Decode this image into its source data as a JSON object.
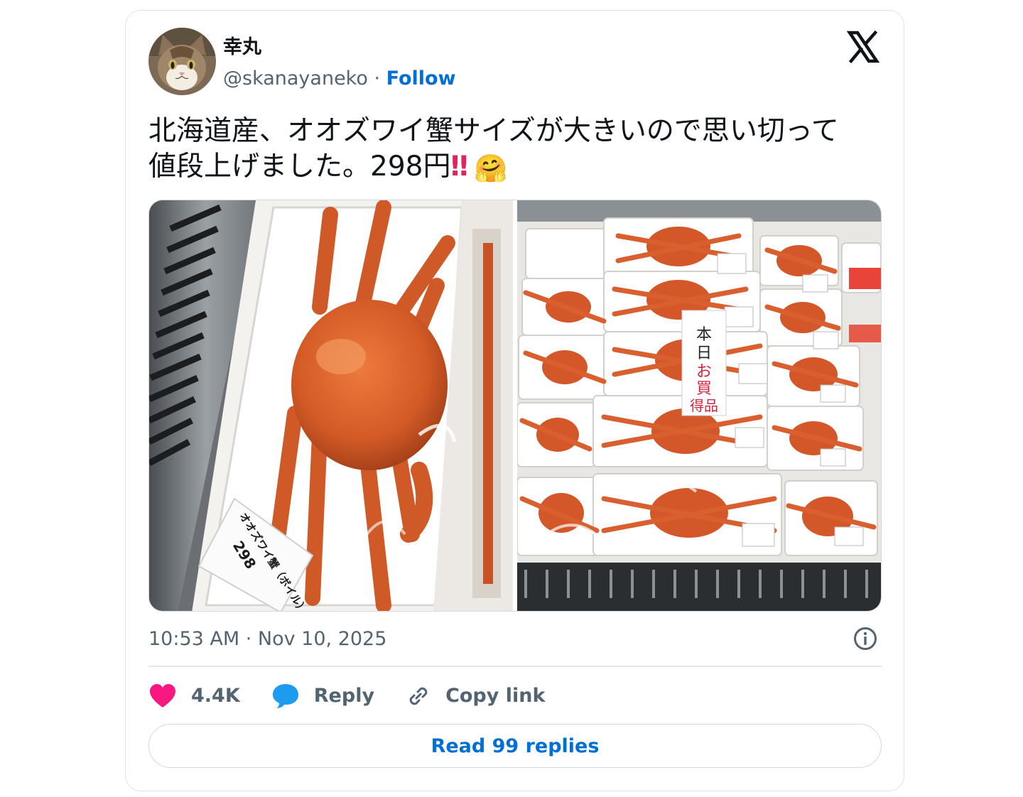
{
  "author": {
    "display_name": "幸丸",
    "handle": "@skanayaneko",
    "separator": " · ",
    "follow_label": "Follow",
    "avatar_icon": "cat-avatar"
  },
  "tweet": {
    "text_line1": "北海道産、オオズワイ蟹サイズが大きいので思い切って",
    "text_line2": "値段上げました。298円",
    "emphasis": "‼",
    "hug_emoji": "🤗",
    "timestamp": "10:53 AM · Nov 10, 2025"
  },
  "media": {
    "photo_count": 2,
    "photo1_icon": "crab-package-photo",
    "photo2_icon": "crab-display-case-photo",
    "sign_text": "本日お買得品",
    "label_text": "オオズワイ蟹（ボイル）",
    "label_price": "298"
  },
  "actions": {
    "likes_count": "4.4K",
    "reply_label": "Reply",
    "copy_link_label": "Copy link",
    "read_replies_label": "Read 99 replies"
  },
  "colors": {
    "link_blue": "#006fd6",
    "like_pink": "#f91880",
    "reply_blue": "#1d9bf0",
    "muted_text": "#536471",
    "border": "#cfd9de"
  }
}
